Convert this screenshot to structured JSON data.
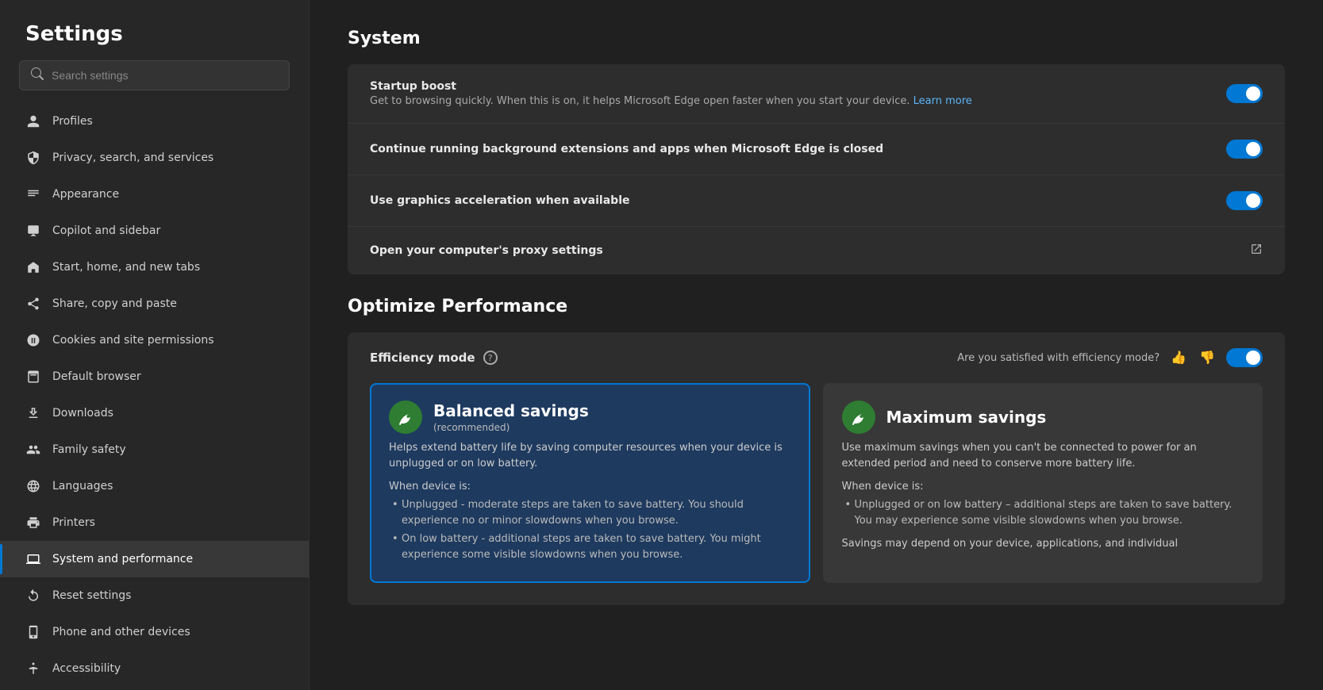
{
  "sidebar": {
    "title": "Settings",
    "search_placeholder": "Search settings",
    "items": [
      {
        "id": "profiles",
        "label": "Profiles",
        "icon": "👤"
      },
      {
        "id": "privacy",
        "label": "Privacy, search, and services",
        "icon": "🔒"
      },
      {
        "id": "appearance",
        "label": "Appearance",
        "icon": "🖥️"
      },
      {
        "id": "copilot",
        "label": "Copilot and sidebar",
        "icon": "📋"
      },
      {
        "id": "start-home",
        "label": "Start, home, and new tabs",
        "icon": "⬜"
      },
      {
        "id": "share-copy",
        "label": "Share, copy and paste",
        "icon": "📎"
      },
      {
        "id": "cookies",
        "label": "Cookies and site permissions",
        "icon": "📊"
      },
      {
        "id": "default-browser",
        "label": "Default browser",
        "icon": "🖨️"
      },
      {
        "id": "downloads",
        "label": "Downloads",
        "icon": "⬇️"
      },
      {
        "id": "family-safety",
        "label": "Family safety",
        "icon": "👨‍👩‍👧"
      },
      {
        "id": "languages",
        "label": "Languages",
        "icon": "🚶"
      },
      {
        "id": "printers",
        "label": "Printers",
        "icon": "🖨️"
      },
      {
        "id": "system-performance",
        "label": "System and performance",
        "icon": "💻",
        "active": true
      },
      {
        "id": "reset-settings",
        "label": "Reset settings",
        "icon": "↺"
      },
      {
        "id": "phone-devices",
        "label": "Phone and other devices",
        "icon": "📱"
      },
      {
        "id": "accessibility",
        "label": "Accessibility",
        "icon": "♿"
      }
    ]
  },
  "main": {
    "system_section": {
      "title": "System",
      "settings": [
        {
          "id": "startup-boost",
          "label": "Startup boost",
          "desc": "Get to browsing quickly. When this is on, it helps Microsoft Edge open faster when you start your device.",
          "link_text": "Learn more",
          "has_toggle": true,
          "toggle_on": true
        },
        {
          "id": "background-extensions",
          "label": "Continue running background extensions and apps when Microsoft Edge is closed",
          "has_toggle": true,
          "toggle_on": true
        },
        {
          "id": "graphics-acceleration",
          "label": "Use graphics acceleration when available",
          "has_toggle": true,
          "toggle_on": true
        },
        {
          "id": "proxy-settings",
          "label": "Open your computer's proxy settings",
          "has_external_link": true
        }
      ]
    },
    "performance_section": {
      "title": "Optimize Performance",
      "efficiency_label": "Efficiency mode",
      "feedback_text": "Are you satisfied with efficiency mode?",
      "toggle_on": true,
      "modes": [
        {
          "id": "balanced",
          "title": "Balanced savings",
          "subtitle": "(recommended)",
          "desc": "Helps extend battery life by saving computer resources when your device is unplugged or on low battery.",
          "when_label": "When device is:",
          "bullets": [
            "Unplugged - moderate steps are taken to save battery. You should experience no or minor slowdowns when you browse.",
            "On low battery - additional steps are taken to save battery. You might experience some visible slowdowns when you browse."
          ],
          "selected": true,
          "icon": "🌿"
        },
        {
          "id": "maximum",
          "title": "Maximum savings",
          "subtitle": "",
          "desc": "Use maximum savings when you can't be connected to power for an extended period and need to conserve more battery life.",
          "when_label": "When device is:",
          "bullets": [
            "Unplugged or on low battery – additional steps are taken to save battery. You may experience some visible slowdowns when you browse."
          ],
          "extra_text": "Savings may depend on your device, applications, and individual",
          "selected": false,
          "icon": "🌿"
        }
      ]
    }
  }
}
